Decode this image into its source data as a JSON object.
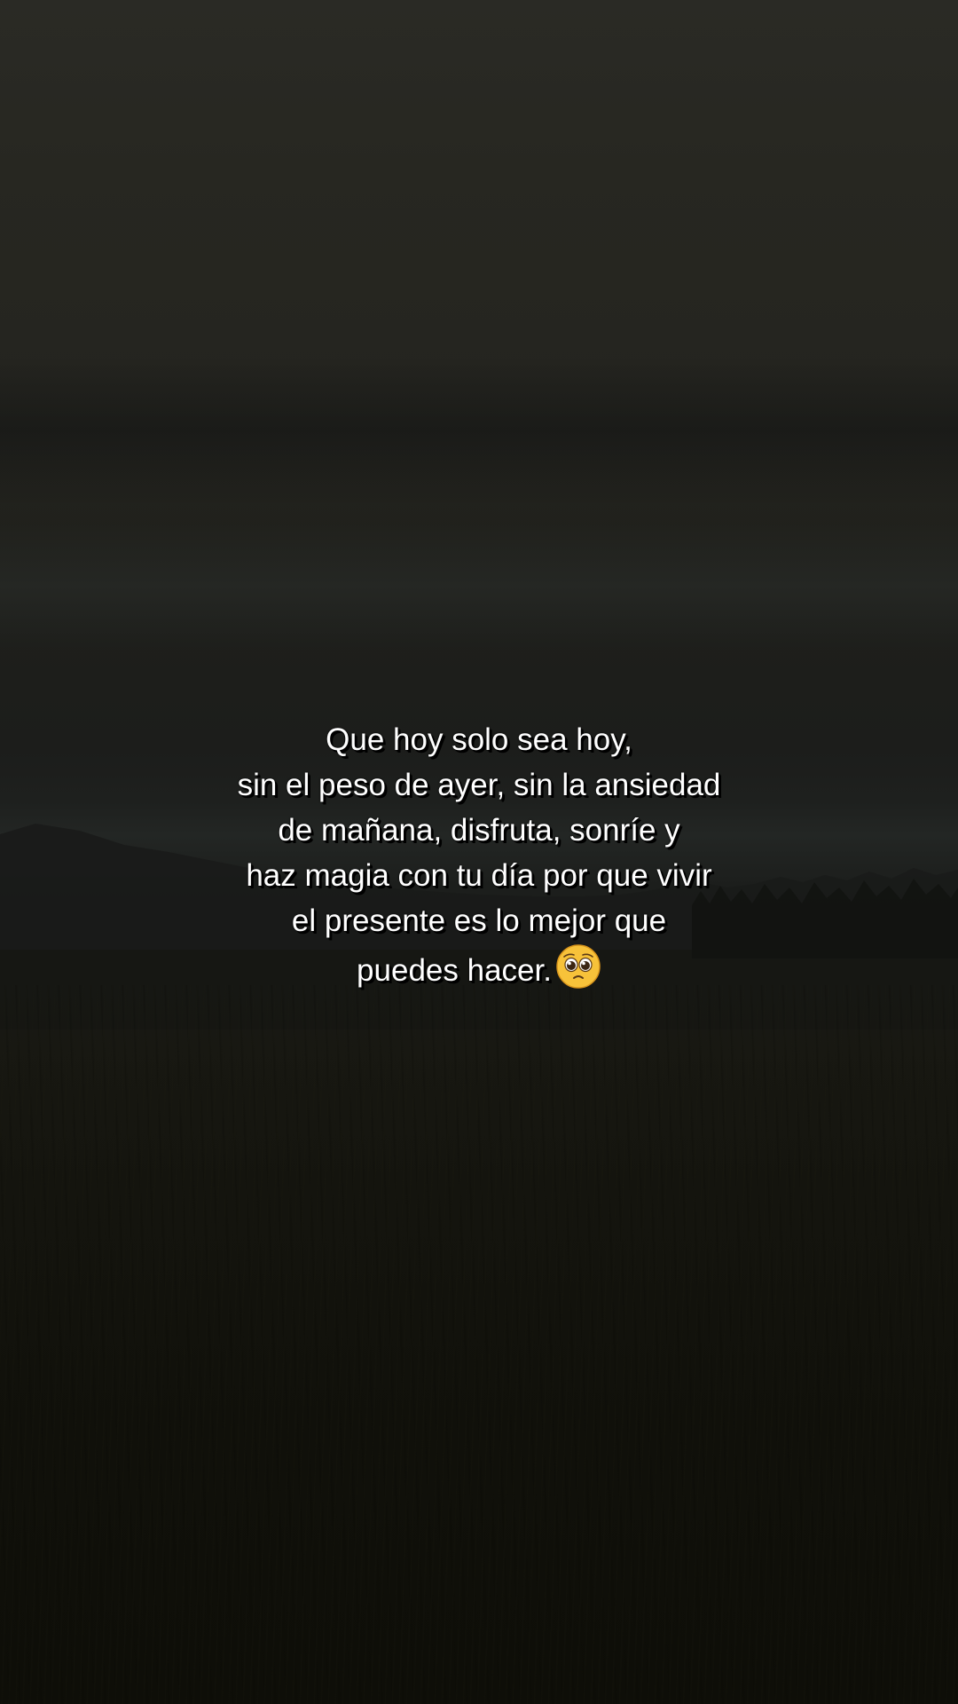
{
  "caption": {
    "lines": [
      "Que hoy solo sea hoy,",
      "sin el peso de ayer, sin la ansiedad",
      "de mañana, disfruta, sonríe y",
      "haz magia con tu día por que vivir",
      "el presente es lo mejor que",
      "puedes hacer."
    ],
    "emoji_icon": "pleading-face-icon"
  },
  "colors": {
    "text": "#ffffff",
    "text_shadow": "#000000",
    "sky": "#2a2a25",
    "ground": "#13130d"
  }
}
